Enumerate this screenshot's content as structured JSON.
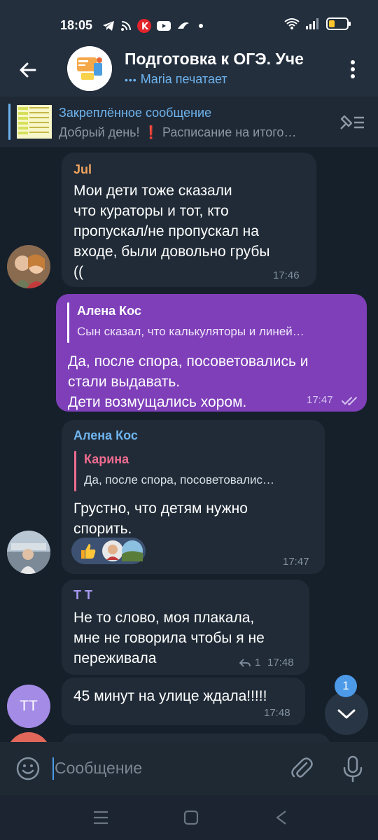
{
  "status": {
    "time": "18:05",
    "battery_color": "#ffc62d"
  },
  "header": {
    "title": "Подготовка к ОГЭ. Уче",
    "subtitle": "Maria печатает"
  },
  "pinned": {
    "title": "Закреплённое сообщение",
    "text": "Добрый день! ❗ Расписание на итого…"
  },
  "messages": [
    {
      "sender": "Jul",
      "lines": [
        "Мои дети тоже сказали",
        "что кураторы и тот, кто",
        "пропускал/не пропускал на",
        "входе, были довольно грубы",
        "(("
      ],
      "time": "17:46"
    },
    {
      "reply_name": "Алена Кос",
      "reply_text": "Сын сказал, что калькуляторы и линей…",
      "lines": [
        "Да, после спора, посоветовались и",
        "стали выдавать.",
        "Дети возмущались хором."
      ],
      "time": "17:47"
    },
    {
      "sender": "Алена Кос",
      "reply_name": "Карина",
      "reply_text": "Да, после спора, посоветовалис…",
      "lines": [
        "Грустно, что детям нужно",
        "спорить."
      ],
      "time": "17:47"
    },
    {
      "sender": "T T",
      "lines": [
        "Не то слово, моя плакала,",
        "мне не говорила чтобы я не",
        "переживала"
      ],
      "reply_count": "1",
      "time": "17:48"
    },
    {
      "lines": [
        "45 минут на улице ждала!!!!!"
      ],
      "time": "17:48"
    }
  ],
  "tt_initials": "TT",
  "unread_count": "1",
  "composer": {
    "placeholder": "Сообщение"
  },
  "colors": {
    "accent": "#6fb4ee",
    "outgoing": "#7e3fb9",
    "incoming": "#202b37"
  }
}
